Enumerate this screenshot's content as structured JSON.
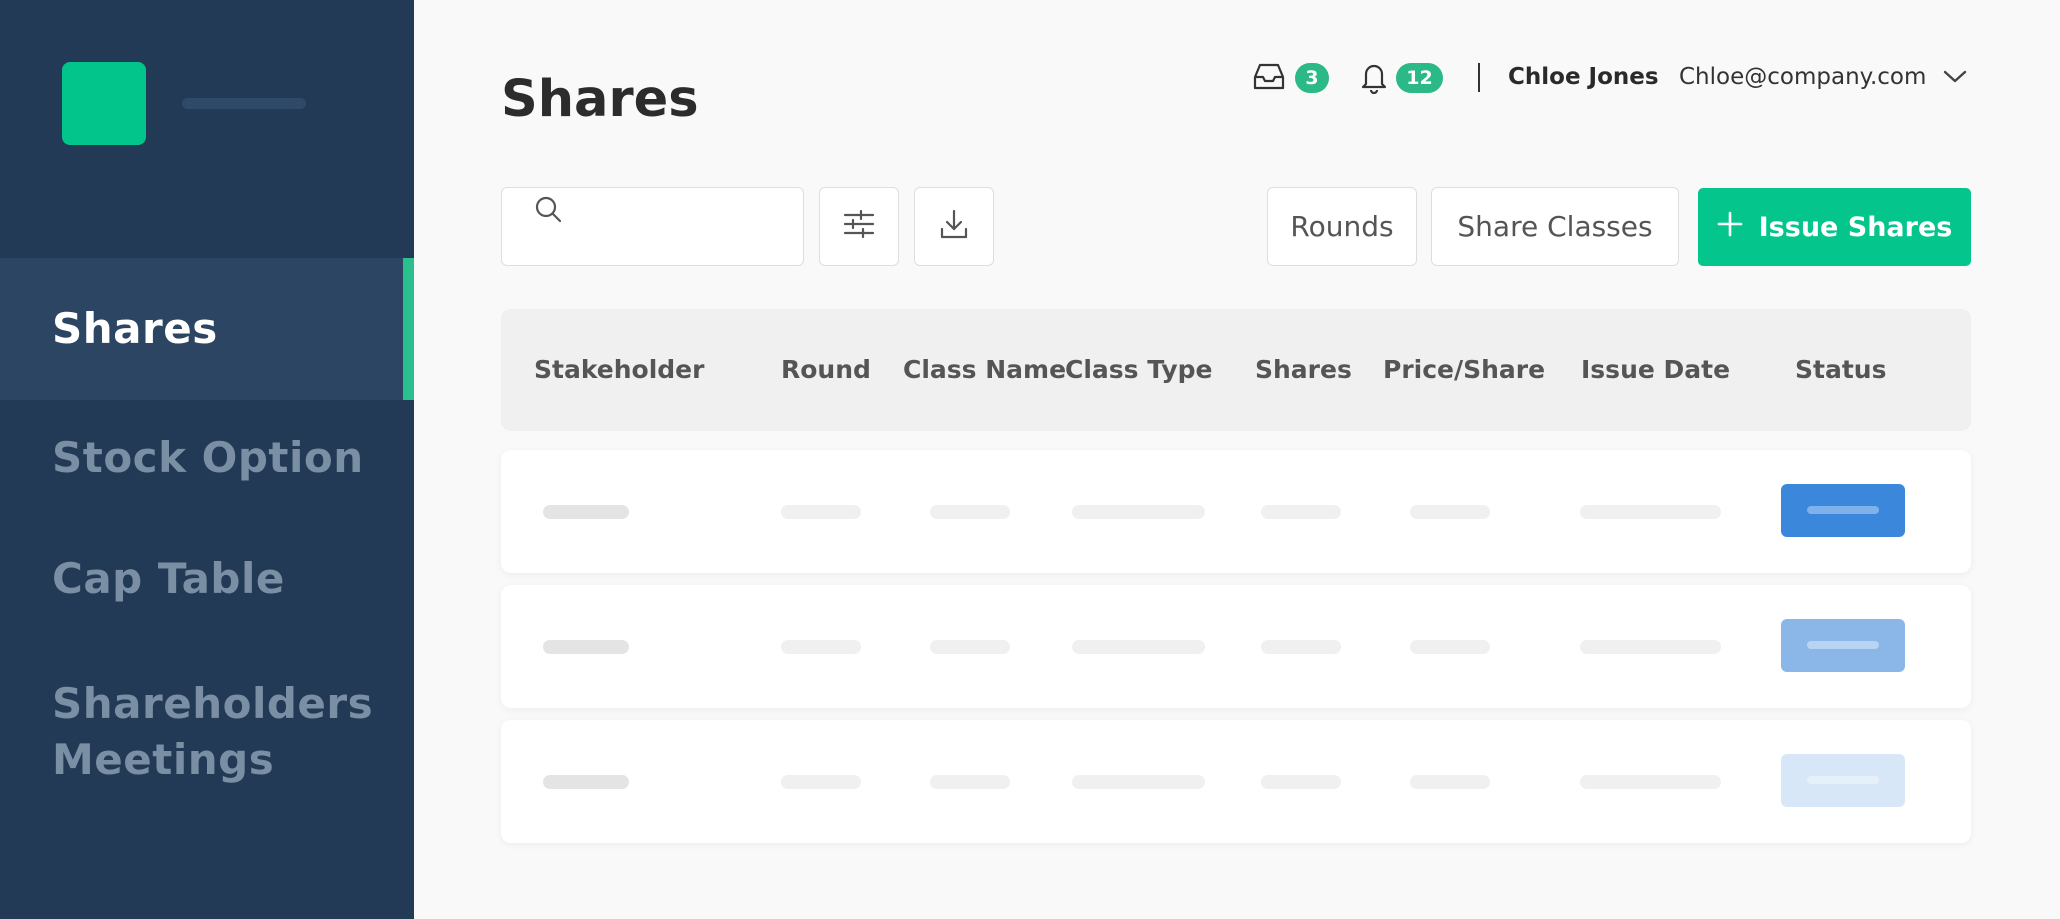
{
  "sidebar": {
    "items": [
      {
        "label": "Shares",
        "active": true
      },
      {
        "label": "Stock Option"
      },
      {
        "label": "Cap Table"
      },
      {
        "label": "Shareholders Meetings"
      }
    ]
  },
  "header": {
    "title": "Shares",
    "inbox_count": "3",
    "notification_count": "12",
    "user_name": "Chloe Jones",
    "user_email": "Chloe@company.com"
  },
  "toolbar": {
    "search_placeholder": "",
    "rounds_label": "Rounds",
    "share_classes_label": "Share Classes",
    "issue_shares_label": "Issue Shares"
  },
  "table": {
    "columns": [
      "Stakeholder",
      "Round",
      "Class Name",
      "Class Type",
      "Shares",
      "Price/Share",
      "Issue Date",
      "Status"
    ],
    "status_colors": [
      "#3a87db",
      "#8bb7e8",
      "#d8e7f7"
    ]
  },
  "colors": {
    "sidebar_bg": "#223a56",
    "accent_green": "#04c58c",
    "status_blue": "#3a87db"
  }
}
